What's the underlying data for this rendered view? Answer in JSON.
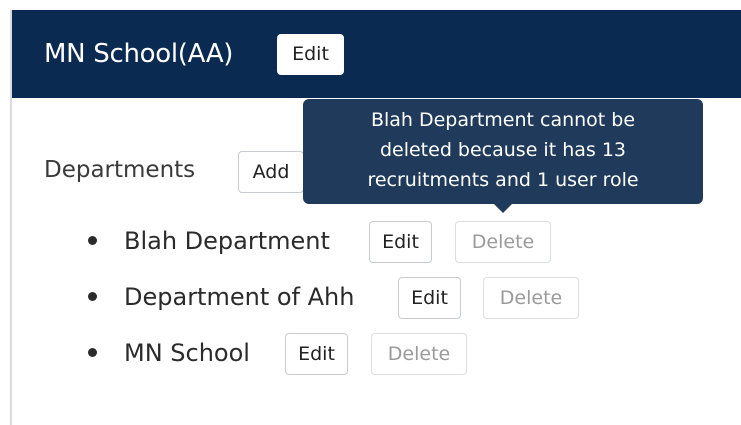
{
  "header": {
    "school_name": "MN School(AA)",
    "edit_label": "Edit"
  },
  "departments": {
    "heading": "Departments",
    "add_label": "Add",
    "items": [
      {
        "name": "Blah Department",
        "edit_label": "Edit",
        "delete_label": "Delete"
      },
      {
        "name": "Department of Ahh",
        "edit_label": "Edit",
        "delete_label": "Delete"
      },
      {
        "name": "MN School",
        "edit_label": "Edit",
        "delete_label": "Delete"
      }
    ]
  },
  "tooltip": {
    "lines": [
      "Blah Department cannot be",
      "deleted because it has 13",
      "recruitments and 1 user role"
    ]
  },
  "colors": {
    "header_bg": "#0b2a52",
    "tooltip_bg": "#1f3a5a",
    "disabled_text": "#9a9a9a"
  }
}
